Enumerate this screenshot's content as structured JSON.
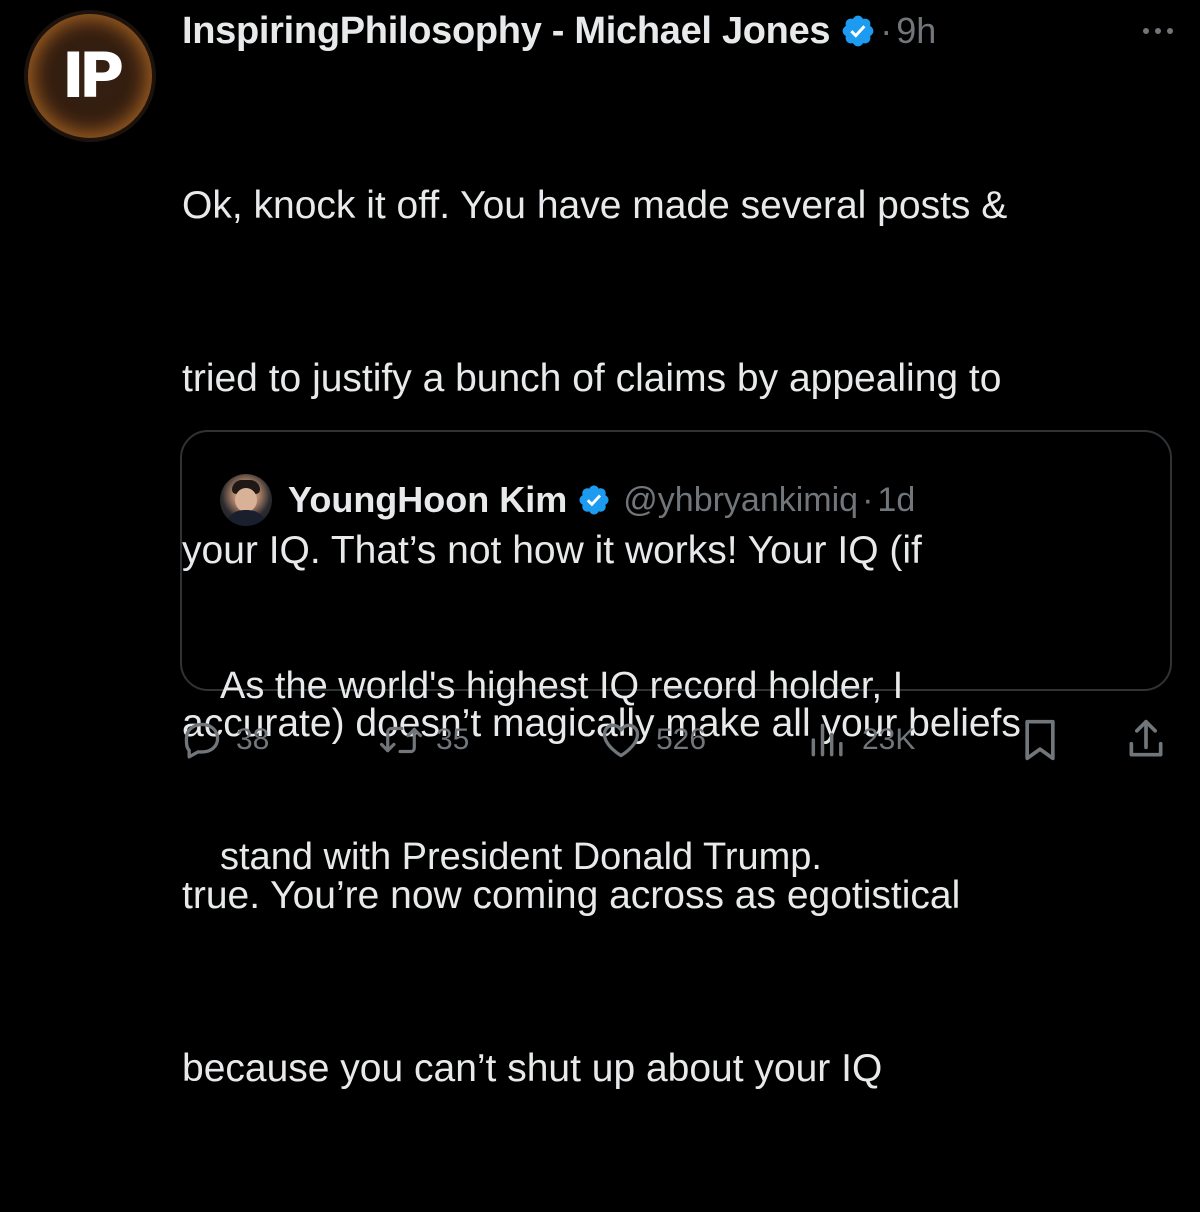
{
  "tweet": {
    "author": {
      "display_name": "InspiringPhilosophy - Michael Jones",
      "avatar_initials": "IP",
      "verified": true
    },
    "dot": "·",
    "time": "9h",
    "lines": [
      "Ok, knock it off. You have made several posts &",
      "tried to justify a bunch of claims by appealing to",
      "your IQ. That’s not how it works! Your IQ (if",
      "accurate) doesn’t magically make all your beliefs",
      "true. You’re now coming across as egotistical",
      "because you can’t shut up about your IQ"
    ],
    "more_icon": "ellipsis-icon"
  },
  "quoted": {
    "display_name": "YoungHoon Kim",
    "verified": true,
    "handle": "@yhbryankimiq",
    "dot": "·",
    "time": "1d",
    "lines": [
      "As the world's highest IQ record holder, I",
      "stand with President Donald Trump."
    ]
  },
  "actions": {
    "replies": "38",
    "retweets": "35",
    "likes": "526",
    "views": "23K"
  },
  "colors": {
    "background": "#000000",
    "text": "#e7e9ea",
    "muted": "#71767b",
    "verified_blue": "#1d9bf0",
    "border": "#2f3336"
  }
}
